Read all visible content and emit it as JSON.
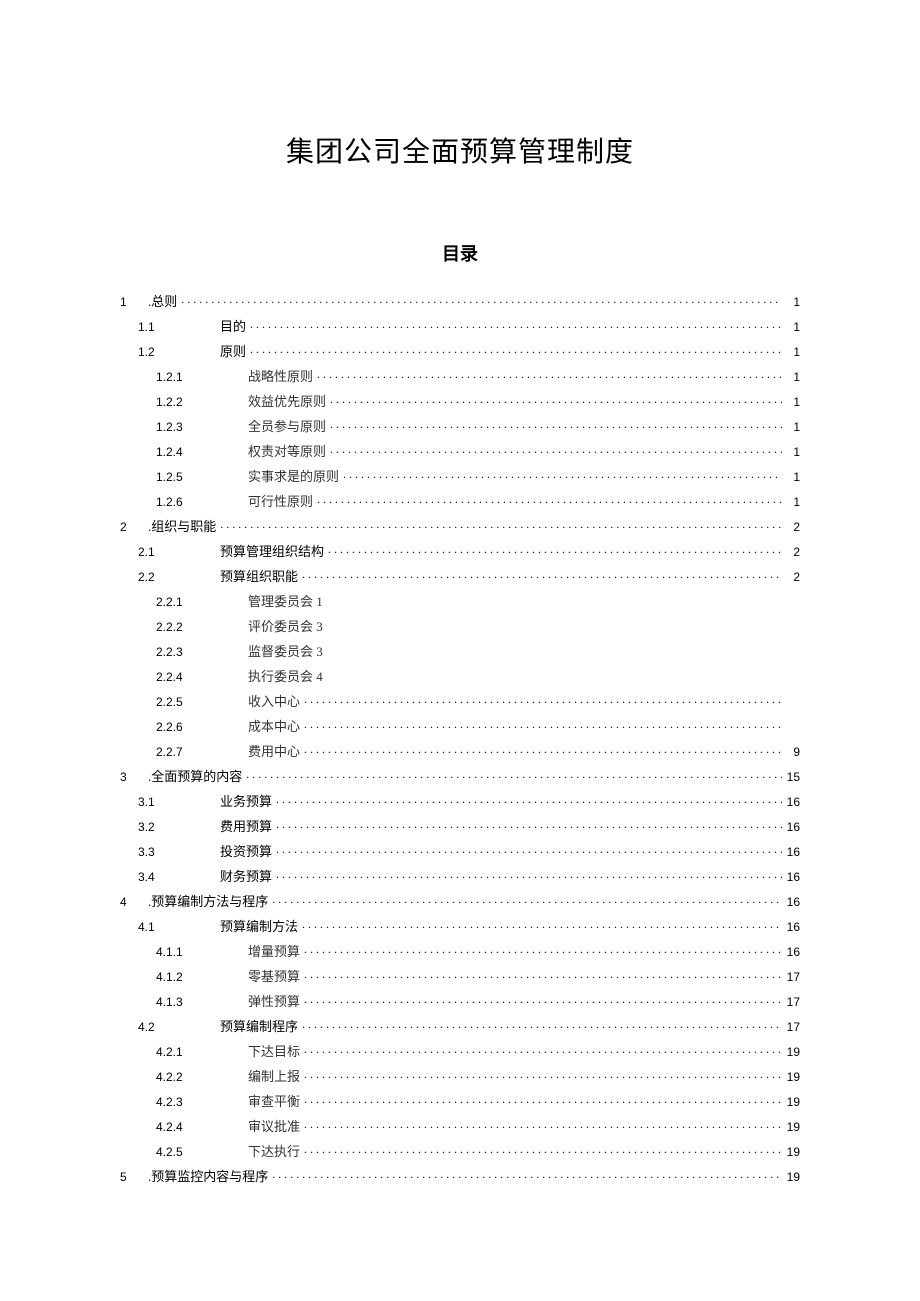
{
  "title": "集团公司全面预算管理制度",
  "toc_heading": "目录",
  "toc": [
    {
      "level": 1,
      "num": "1",
      "label": ".总则",
      "page": "1",
      "leader": true
    },
    {
      "level": 2,
      "num": "1.1",
      "label": "目的",
      "page": "1",
      "leader": true
    },
    {
      "level": 2,
      "num": "1.2",
      "label": "原则",
      "page": "1",
      "leader": true
    },
    {
      "level": 3,
      "num": "1.2.1",
      "label": "战略性原则",
      "page": "1",
      "leader": true
    },
    {
      "level": 3,
      "num": "1.2.2",
      "label": "效益优先原则",
      "page": "1",
      "leader": true
    },
    {
      "level": 3,
      "num": "1.2.3",
      "label": "全员参与原则",
      "page": "1",
      "leader": true
    },
    {
      "level": 3,
      "num": "1.2.4",
      "label": "权责对等原则",
      "page": "1",
      "leader": true
    },
    {
      "level": 3,
      "num": "1.2.5",
      "label": "实事求是的原则",
      "page": "1",
      "leader": true
    },
    {
      "level": 3,
      "num": "1.2.6",
      "label": "可行性原则",
      "page": "1",
      "leader": true
    },
    {
      "level": 1,
      "num": "2",
      "label": ".组织与职能",
      "page": "2",
      "leader": true
    },
    {
      "level": 2,
      "num": "2.1",
      "label": "预算管理组织结构",
      "page": "2",
      "leader": true
    },
    {
      "level": 2,
      "num": "2.2",
      "label": "预算组织职能",
      "page": "2",
      "leader": true
    },
    {
      "level": 3,
      "num": "2.2.1",
      "label": "管理委员会 1",
      "page": "",
      "leader": false
    },
    {
      "level": 3,
      "num": "2.2.2",
      "label": "评价委员会 3",
      "page": "",
      "leader": false
    },
    {
      "level": 3,
      "num": "2.2.3",
      "label": "监督委员会 3",
      "page": "",
      "leader": false
    },
    {
      "level": 3,
      "num": "2.2.4",
      "label": "执行委员会 4",
      "page": "",
      "leader": false
    },
    {
      "level": 3,
      "num": "2.2.5",
      "label": "收入中心",
      "page": "",
      "leader": true
    },
    {
      "level": 3,
      "num": "2.2.6",
      "label": "成本中心",
      "page": "",
      "leader": true
    },
    {
      "level": 3,
      "num": "2.2.7",
      "label": "费用中心",
      "page": "9",
      "leader": true
    },
    {
      "level": 1,
      "num": "3",
      "label": ".全面预算的内容",
      "page": "15",
      "leader": true
    },
    {
      "level": 2,
      "num": "3.1",
      "label": "业务预算",
      "page": "16",
      "leader": true
    },
    {
      "level": 2,
      "num": "3.2",
      "label": "费用预算",
      "page": "16",
      "leader": true
    },
    {
      "level": 2,
      "num": "3.3",
      "label": "投资预算",
      "page": "16",
      "leader": true
    },
    {
      "level": 2,
      "num": "3.4",
      "label": "财务预算",
      "page": "16",
      "leader": true
    },
    {
      "level": 1,
      "num": "4",
      "label": ".预算编制方法与程序",
      "page": "16",
      "leader": true
    },
    {
      "level": 2,
      "num": "4.1",
      "label": "预算编制方法",
      "page": "16",
      "leader": true
    },
    {
      "level": 3,
      "num": "4.1.1",
      "label": "增量预算",
      "page": "16",
      "leader": true
    },
    {
      "level": 3,
      "num": "4.1.2",
      "label": "零基预算",
      "page": "17",
      "leader": true
    },
    {
      "level": 3,
      "num": "4.1.3",
      "label": "弹性预算",
      "page": "17",
      "leader": true
    },
    {
      "level": 2,
      "num": "4.2",
      "label": "预算编制程序",
      "page": "17",
      "leader": true
    },
    {
      "level": 3,
      "num": "4.2.1",
      "label": "下达目标",
      "page": "19",
      "leader": true
    },
    {
      "level": 3,
      "num": "4.2.2",
      "label": "编制上报",
      "page": "19",
      "leader": true
    },
    {
      "level": 3,
      "num": "4.2.3",
      "label": "审查平衡",
      "page": "19",
      "leader": true
    },
    {
      "level": 3,
      "num": "4.2.4",
      "label": "审议批准",
      "page": "19",
      "leader": true
    },
    {
      "level": 3,
      "num": "4.2.5",
      "label": "下达执行",
      "page": "19",
      "leader": true
    },
    {
      "level": 1,
      "num": "5",
      "label": ".预算监控内容与程序",
      "page": "19",
      "leader": true
    }
  ]
}
